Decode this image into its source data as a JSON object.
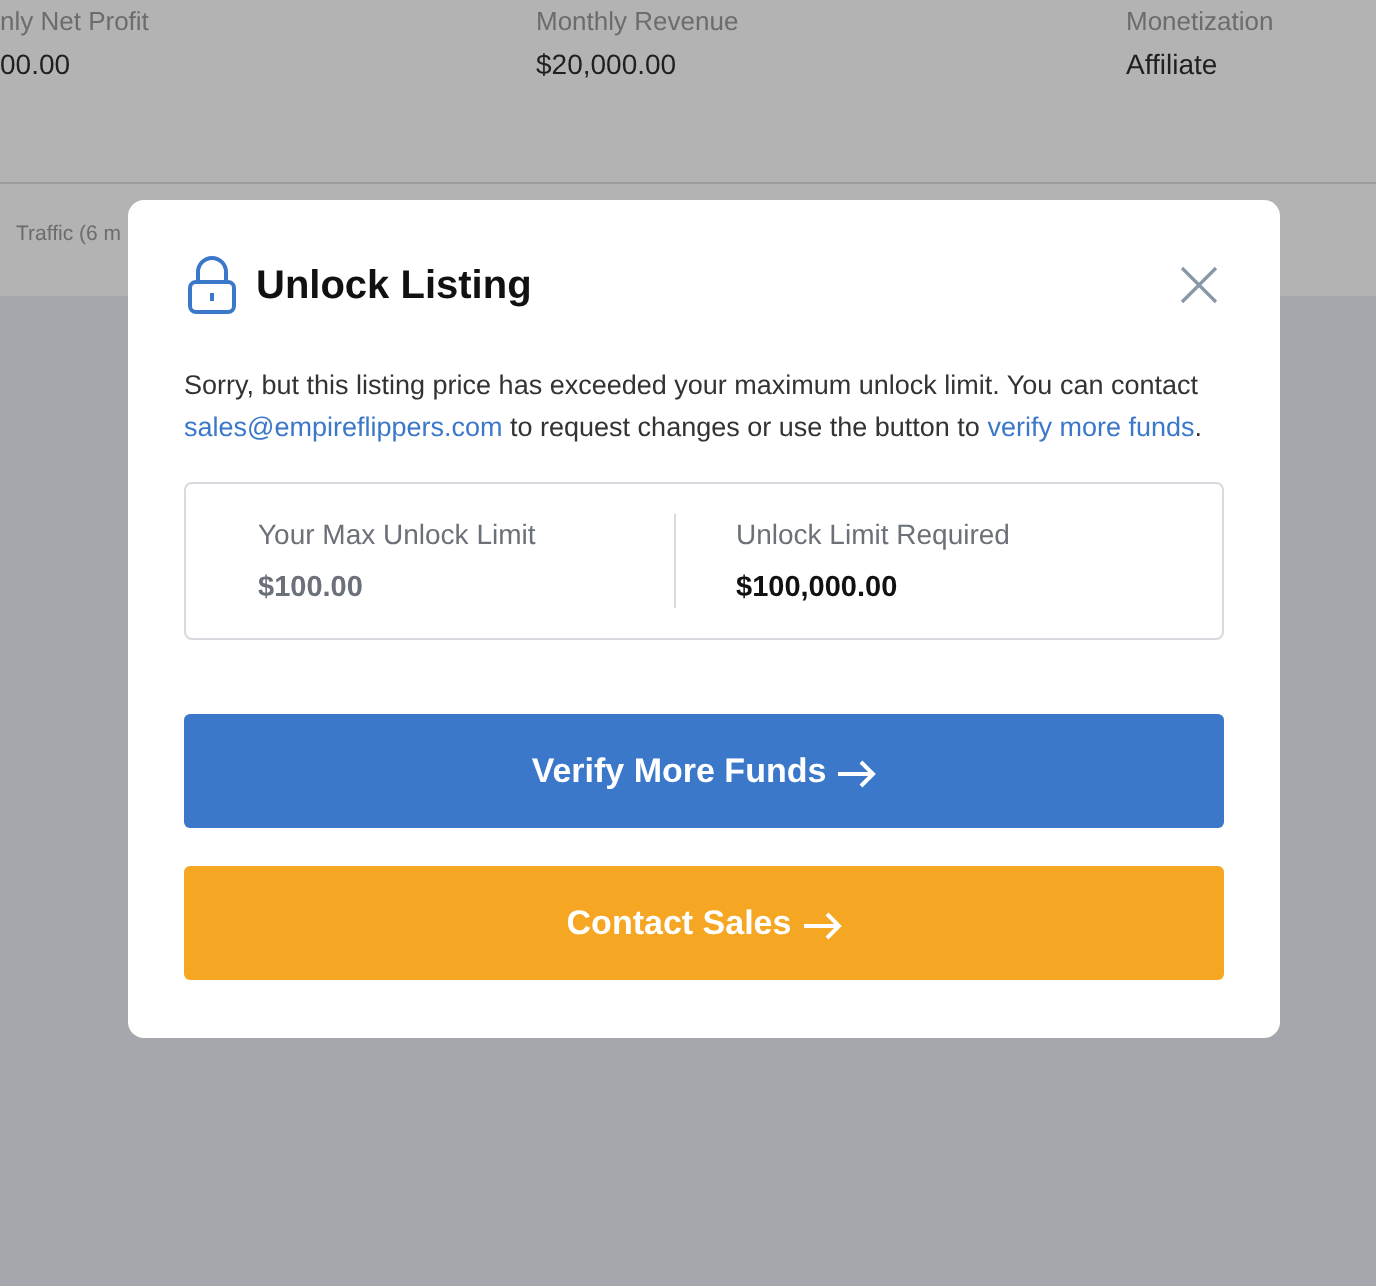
{
  "background_page": {
    "stats": [
      {
        "label": "nly Net Profit",
        "value": "00.00"
      },
      {
        "label": "Monthly Revenue",
        "value": "$20,000.00"
      },
      {
        "label": "Monetization",
        "value": "Affiliate"
      }
    ],
    "section_tab": "Traffic (6 m"
  },
  "dialog": {
    "title": "Unlock Listing",
    "message": [
      {
        "kind": "text",
        "text": "Sorry, but this listing price has exceeded your maximum unlock limit. You can contact "
      },
      {
        "kind": "link",
        "text": "sales@empireflippers.com"
      },
      {
        "kind": "text",
        "text": " to request changes or use the button to "
      },
      {
        "kind": "link",
        "text": "verify more funds"
      },
      {
        "kind": "text",
        "text": "."
      }
    ],
    "limits": [
      {
        "label": "Your Max Unlock Limit",
        "value": "$100.00",
        "muted": true
      },
      {
        "label": "Unlock Limit Required",
        "value": "$100,000.00",
        "muted": false
      }
    ],
    "buttons": [
      {
        "label": "Verify More Funds",
        "color": "#3b78c9"
      },
      {
        "label": "Contact Sales",
        "color": "#f5a623"
      }
    ]
  }
}
